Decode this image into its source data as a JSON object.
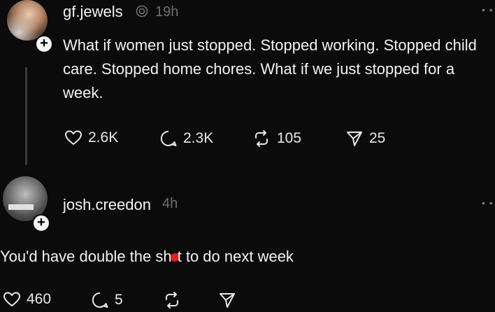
{
  "post": {
    "username": "gf.jewels",
    "time": "19h",
    "text": "What if women just stopped. Stopped working. Stopped child care. Stopped home chores. What if we just stopped for a week.",
    "likes": "2.6K",
    "comments": "2.3K",
    "reposts": "105",
    "shares": "25"
  },
  "reply": {
    "username": "josh.creedon",
    "time": "4h",
    "text_before": "You'd have double the sh",
    "text_after": "t to do next week",
    "likes": "460",
    "comments": "5"
  },
  "icons": {
    "follow": "plus-icon",
    "like": "heart-icon",
    "comment": "comment-icon",
    "repost": "repost-icon",
    "share": "send-icon",
    "more": "more-dots-icon",
    "verified": "verified-icon"
  },
  "colors": {
    "background": "#0b0b0b",
    "text": "#f2f2f2",
    "muted": "#707070",
    "redaction": "#e02020"
  },
  "plus_glyph": "+",
  "more_glyph": "• •"
}
